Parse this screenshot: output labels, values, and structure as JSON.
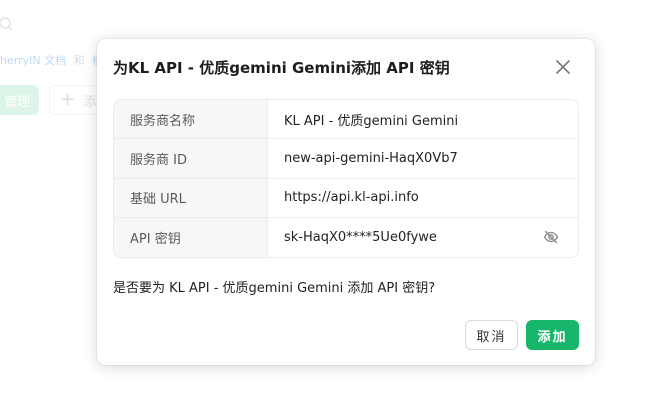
{
  "background": {
    "links_text": "herryIN 文档",
    "links_sep": "和",
    "links_text2": "模",
    "manage_label": "管理",
    "add_label": "添"
  },
  "dialog": {
    "title": "为KL API - 优质gemini Gemini添加 API 密钥",
    "rows": [
      {
        "label": "服务商名称",
        "value": "KL API - 优质gemini Gemini"
      },
      {
        "label": "服务商 ID",
        "value": "new-api-gemini-HaqX0Vb7"
      },
      {
        "label": "基础 URL",
        "value": "https://api.kl-api.info"
      },
      {
        "label": "API 密钥",
        "value": "sk-HaqX0****5Ue0fywe"
      }
    ],
    "confirm_text": "是否要为 KL API - 优质gemini Gemini 添加 API 密钥?",
    "cancel_label": "取消",
    "add_label": "添加"
  },
  "colors": {
    "primary": "#18b66a",
    "border": "#ececec",
    "label_bg": "#f7f7f7"
  },
  "icons": {
    "close": "close-icon",
    "visibility": "eye-off-icon",
    "search": "search-icon",
    "plus": "plus-icon"
  }
}
